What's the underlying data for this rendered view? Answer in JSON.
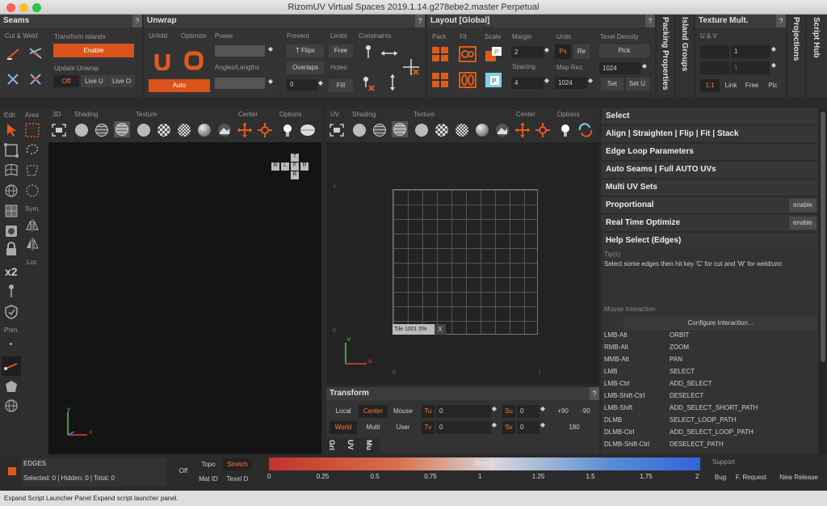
{
  "window": {
    "title": "RizomUV  Virtual Spaces 2019.1.14.g278ebe2.master Perpetual"
  },
  "seams": {
    "title": "Seams",
    "q": "?",
    "cut_weld": "Cut & Weld",
    "transform_islands": "Transform Islands",
    "enable": "Enable",
    "update_unwrap": "Update Unwrap",
    "off": "Off",
    "live_u": "Live U",
    "live_o": "Live O"
  },
  "unwrap": {
    "title": "Unwrap",
    "q": "?",
    "unfold": "Unfold",
    "optimize": "Optimize",
    "power": "Power",
    "prevent": "Prevent",
    "limits": "Limits",
    "constraints": "Constraints",
    "t_flips": "T Flips",
    "free": "Free",
    "angles_lengths": "Angles/Lengths",
    "overlaps": "Overlaps",
    "holes": "Holes",
    "fill": "Fill",
    "auto": "Auto",
    "value": "0"
  },
  "layout": {
    "title": "Layout [Global]",
    "q": "?",
    "pack": "Pack",
    "fit": "Fit",
    "scale": "Scale",
    "margin": "Margin",
    "units": "Units",
    "texel_density": "Texel Density",
    "margin_val": "2",
    "px": "Px",
    "re": "Re",
    "pick": "Pick",
    "spacing": "Spacing",
    "map_rez": "Map Rez.",
    "spacing_val": "4",
    "map_rez_val": "1024",
    "td_val": "1024",
    "set": "Set",
    "set_u": "Set U."
  },
  "vertical_tabs": {
    "packing": "Packing Properties",
    "island": "Island Groups",
    "projections": "Projections",
    "script_hub": "Script Hub"
  },
  "texture_mult": {
    "title": "Texture Mult.",
    "q": "?",
    "uv": "U & V",
    "v1": "1",
    "v2": "1",
    "one_one": "1:1",
    "link": "Link",
    "free": "Free",
    "pic": "Pic"
  },
  "left_toolbar": {
    "edit": "Edit.",
    "area": "Area",
    "sym": "Sym.",
    "loc": "Loc",
    "x2": "x2",
    "prim": "Prim."
  },
  "view3d": {
    "label": "3D",
    "shading": "Shading",
    "texture": "Texture",
    "center": "Center",
    "options": "Options",
    "gizmo": [
      "T",
      "B",
      "L",
      "F",
      "R",
      "B"
    ],
    "axis_y": "y",
    "axis_x": "x"
  },
  "viewuv": {
    "label": "UV",
    "shading": "Shading",
    "texture": "Texture",
    "center": "Center",
    "options": "Options",
    "tile": "Tile 1001 0%",
    "tile_x": "X",
    "axis_v": "v",
    "axis_u": "u",
    "tick_1": "1",
    "tick_0": "0",
    "tick_0b": "0",
    "tick_1b": "1"
  },
  "transform": {
    "title": "Transform",
    "q": "?",
    "local": "Local",
    "center": "Center",
    "mouse": "Mouse",
    "world": "World",
    "multi": "Multi",
    "user": "User",
    "tu": "Tu",
    "tv": "Tv",
    "su": "Su",
    "sv": "Sv",
    "tu_val": "0",
    "tv_val": "0",
    "su_val": "0",
    "sv_val": "0",
    "p90": "+90",
    "m90": "-90",
    "r180": "180",
    "vtabs": [
      "Gri",
      "UV",
      "Mu"
    ]
  },
  "right_panel": {
    "items": [
      "Select",
      "Align | Straighten | Flip | Fit | Stack",
      "Edge Loop Parameters",
      "Auto Seams | Full AUTO UVs",
      "Multi UV Sets",
      "Proportional",
      "Real Time Optimize",
      "Help Select (Edges)"
    ],
    "enable": "enable",
    "tips_label": "Tip(s)",
    "tip_text": "Select some edges then hit key 'C' for cut and 'W' for weld/unc",
    "mouse_interaction": "Mouse Interaction",
    "configure": "Configure Interaction...",
    "bindings": [
      {
        "key": "LMB-Alt",
        "action": "ORBIT"
      },
      {
        "key": "RMB-Alt",
        "action": "ZOOM"
      },
      {
        "key": "MMB-Alt",
        "action": "PAN"
      },
      {
        "key": "LMB",
        "action": "SELECT"
      },
      {
        "key": "LMB-Ctrl",
        "action": "ADD_SELECT"
      },
      {
        "key": "LMB-Shift-Ctrl",
        "action": "DESELECT"
      },
      {
        "key": "LMB-Shift",
        "action": "ADD_SELECT_SHORT_PATH"
      },
      {
        "key": "DLMB",
        "action": "SELECT_LOOP_PATH"
      },
      {
        "key": "DLMB-Ctrl",
        "action": "ADD_SELECT_LOOP_PATH"
      },
      {
        "key": "DLMB-Shift-Ctrl",
        "action": "DESELECT_PATH"
      }
    ]
  },
  "bottom": {
    "mode": "EDGES",
    "counts": "Selected: 0 | Hidden: 0 | Total: 0",
    "off": "Off",
    "topo": "Topo",
    "stretch": "Stretch",
    "mat_id": "Mat ID",
    "texel_d": "Texel D",
    "bar_label": "Stretch",
    "ticks": [
      "0",
      "0.25",
      "0.5",
      "0.75",
      "1",
      "1.25",
      "1.5",
      "1.75",
      "2"
    ],
    "support": "Support",
    "bug": "Bug",
    "f_request": "F. Request",
    "new_release": "New Release"
  },
  "status": {
    "text": "Expand Script Launcher Panel  Expand script launcher panel."
  },
  "colors": {
    "accent": "#d9531a",
    "bg": "#2b2b2b"
  }
}
